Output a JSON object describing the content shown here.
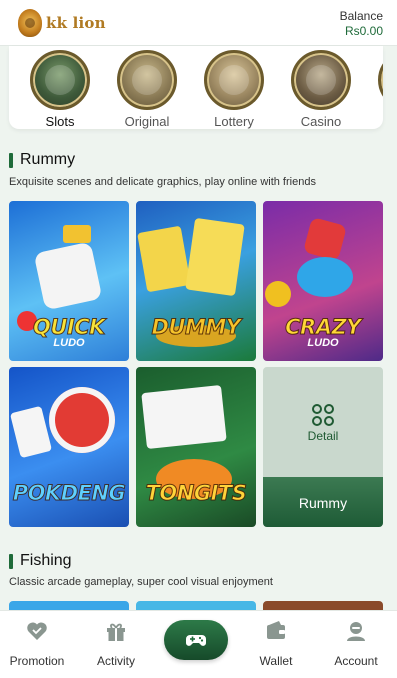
{
  "header": {
    "logo_text": "kk lion",
    "balance_label": "Balance",
    "balance_value": "Rs0.00"
  },
  "categories": [
    {
      "label": "Slots",
      "active": true,
      "icon": "slots-coin-icon"
    },
    {
      "label": "Original",
      "active": false,
      "icon": "original-coin-icon"
    },
    {
      "label": "Lottery",
      "active": false,
      "icon": "lottery-coin-icon"
    },
    {
      "label": "Casino",
      "active": false,
      "icon": "casino-coin-icon"
    }
  ],
  "sections": {
    "rummy": {
      "title": "Rummy",
      "subtitle": "Exquisite scenes and delicate graphics, play online with friends",
      "games": [
        {
          "title": "QUICK",
          "sub": "LUDO",
          "colors": [
            "#1d6fd6",
            "#5ec1f5"
          ]
        },
        {
          "title": "DUMMY",
          "sub": "",
          "colors": [
            "#1f5fc0",
            "#3aa0e0"
          ]
        },
        {
          "title": "CRAZY",
          "sub": "LUDO",
          "colors": [
            "#7a2ca8",
            "#c0448e"
          ]
        },
        {
          "title": "POKDENG",
          "sub": "",
          "colors": [
            "#1454c8",
            "#3b8ef0"
          ]
        },
        {
          "title": "TONGITS",
          "sub": "",
          "colors": [
            "#1b5e2e",
            "#2f8a44"
          ]
        }
      ],
      "detail_label": "Detail",
      "detail_footer": "Rummy"
    },
    "fishing": {
      "title": "Fishing",
      "subtitle": "Classic arcade gameplay, super cool visual enjoyment"
    }
  },
  "tabbar": {
    "items": [
      {
        "label": "Promotion",
        "icon": "promotion-heart-icon"
      },
      {
        "label": "Activity",
        "icon": "gift-icon"
      },
      {
        "label": "Wallet",
        "icon": "wallet-icon"
      },
      {
        "label": "Account",
        "icon": "account-icon"
      }
    ],
    "center_icon": "gamepad-icon"
  },
  "colors": {
    "brand_green": "#1f6b3a",
    "tab_icon_gray": "#8a9690",
    "background": "#eef4ef"
  }
}
